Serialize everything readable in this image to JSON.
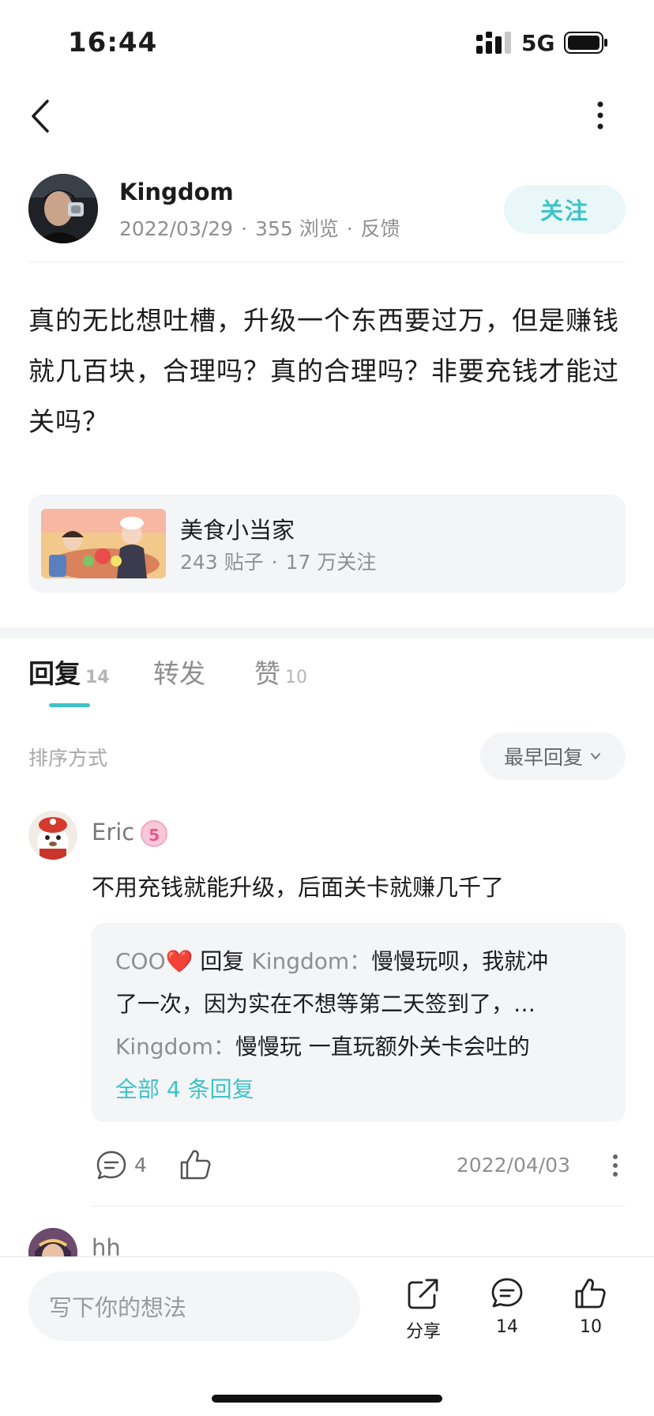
{
  "status_bar": {
    "time": "16:44",
    "network": "5G"
  },
  "author": {
    "name": "Kingdom",
    "date": "2022/03/29",
    "views": "355 浏览",
    "feedback": "反馈",
    "follow_label": "关注"
  },
  "post": {
    "body": "真的无比想吐槽，升级一个东西要过万，但是赚钱就几百块，合理吗？真的合理吗？非要充钱才能过关吗？"
  },
  "game_card": {
    "name": "美食小当家",
    "posts": "243 贴子",
    "followers": "17 万关注"
  },
  "tabs": [
    {
      "label": "回复",
      "count": "14",
      "active": true
    },
    {
      "label": "转发",
      "count": "",
      "active": false
    },
    {
      "label": "赞",
      "count": "10",
      "active": false
    }
  ],
  "sort": {
    "label": "排序方式",
    "selected": "最早回复"
  },
  "comments": [
    {
      "name": "Eric",
      "badge": "5",
      "text": "不用充钱就能升级，后面关卡就赚几千了",
      "replies": [
        {
          "who": "COO",
          "heart": "❤️",
          "verb": " 回复 ",
          "target": "Kingdom：",
          "text": "慢慢玩呗，我就冲"
        },
        {
          "text": "了一次，因为实在不想等第二天签到了，…"
        },
        {
          "who": "Kingdom：",
          "text": "慢慢玩  一直玩额外关卡会吐的"
        }
      ],
      "more_replies": "全部 4 条回复",
      "reply_count": "4",
      "date": "2022/04/03"
    },
    {
      "name": "hh"
    }
  ],
  "bottom_bar": {
    "input_placeholder": "写下你的想法",
    "share_label": "分享",
    "comment_count": "14",
    "like_count": "10"
  },
  "colors": {
    "accent": "#3ec3c9",
    "follow_bg": "#e9f7f8",
    "card_bg": "#f4f5f7"
  },
  "icons": [
    "back-arrow-icon",
    "more-vertical-icon",
    "chevron-down-icon",
    "comment-icon",
    "thumbs-up-icon",
    "share-icon"
  ]
}
